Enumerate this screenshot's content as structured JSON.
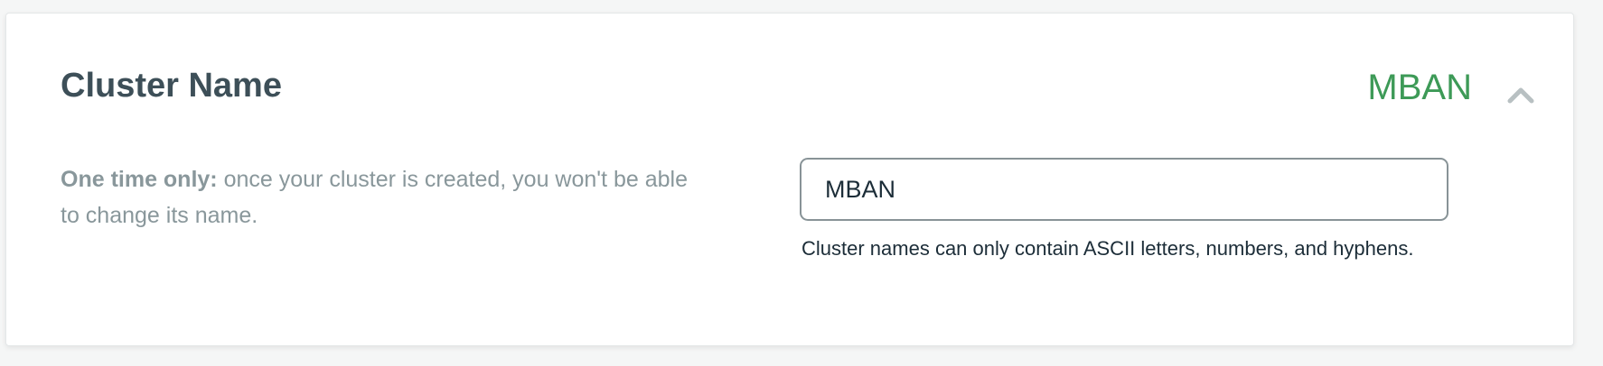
{
  "section": {
    "title": "Cluster Name",
    "summary_value": "MBAN",
    "collapse_icon": "chevron-up-icon",
    "description": {
      "bold_prefix": "One time only:",
      "text": " once your cluster is created, you won't be able to change its name."
    },
    "name_input": {
      "value": "MBAN"
    },
    "helper_text": "Cluster names can only contain ASCII letters, numbers, and hyphens."
  },
  "colors": {
    "accent_green": "#3d9a57",
    "title": "#3d4f58",
    "muted_text": "#89979b"
  }
}
